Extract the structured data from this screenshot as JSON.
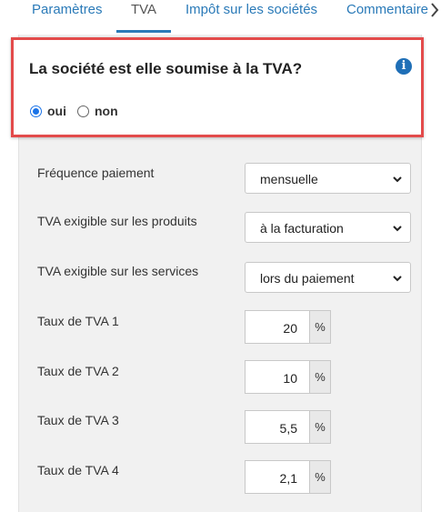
{
  "tabs": [
    {
      "label": "Paramètres"
    },
    {
      "label": "TVA",
      "active": true
    },
    {
      "label": "Impôt sur les sociétés"
    },
    {
      "label": "Commentaire"
    }
  ],
  "question": {
    "title": "La société est elle soumise à la TVA?",
    "options": [
      "oui",
      "non"
    ],
    "selected": "oui"
  },
  "form": {
    "frequence": {
      "label": "Fréquence paiement",
      "value": "mensuelle"
    },
    "produits": {
      "label": "TVA exigible sur les produits",
      "value": "à la facturation"
    },
    "services": {
      "label": "TVA exigible sur les services",
      "value": "lors du paiement"
    },
    "taux1": {
      "label": "Taux de TVA 1",
      "value": "20",
      "unit": "%"
    },
    "taux2": {
      "label": "Taux de TVA 2",
      "value": "10",
      "unit": "%"
    },
    "taux3": {
      "label": "Taux de TVA 3",
      "value": "5,5",
      "unit": "%"
    },
    "taux4": {
      "label": "Taux de TVA 4",
      "value": "2,1",
      "unit": "%"
    }
  },
  "colors": {
    "accent": "#2a7ab8",
    "highlight_border": "#e34b4b",
    "panel_bg": "#f1f1f1"
  }
}
